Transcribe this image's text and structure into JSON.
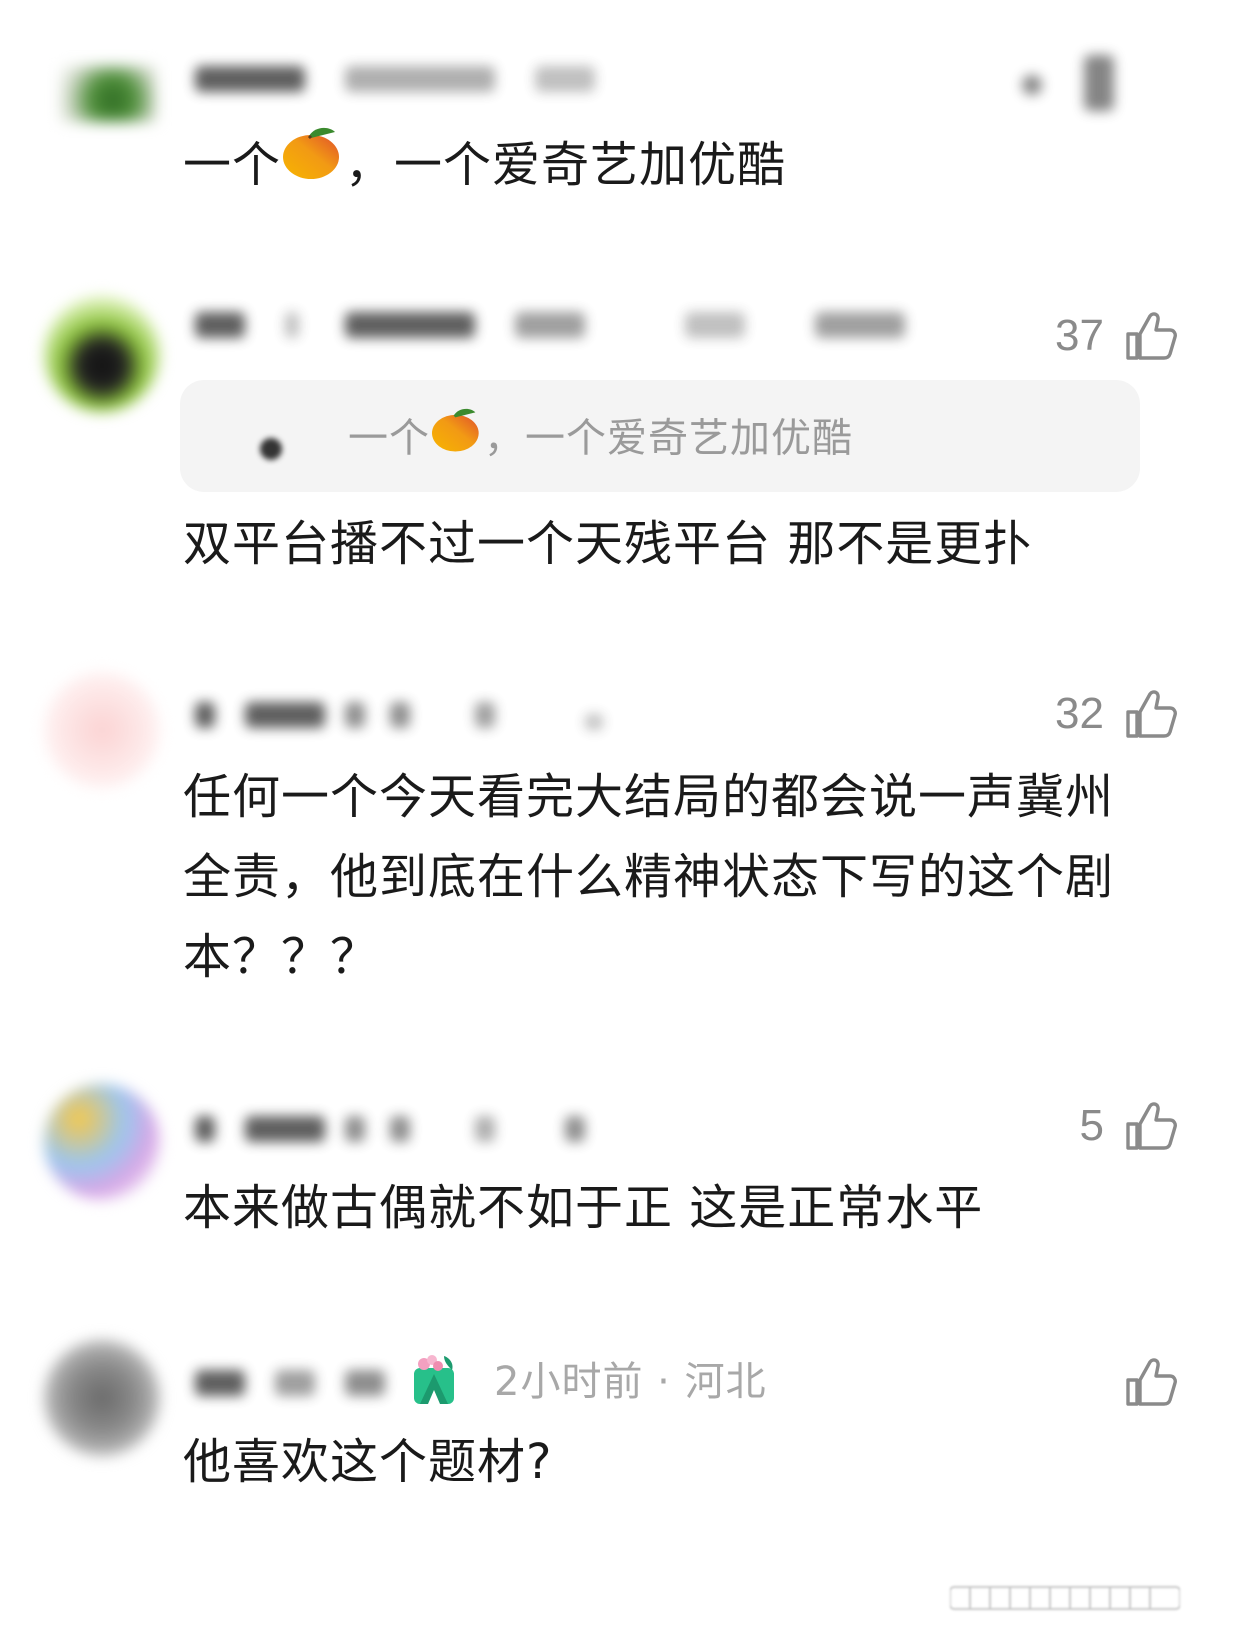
{
  "comments": [
    {
      "text_before": "一个",
      "text_after": "，一个爱奇艺加优酷",
      "text_emoji": "mango"
    },
    {
      "likes": "37",
      "quote_before": "一个",
      "quote_after": "，一个爱奇艺加优酷",
      "text": "双平台播不过一个天残平台 那不是更扑"
    },
    {
      "likes": "32",
      "text": "任何一个今天看完大结局的都会说一声冀州全责，他到底在什么精神状态下写的这个剧本？？？"
    },
    {
      "likes": "5",
      "text": "本来做古偶就不如于正 这是正常水平"
    },
    {
      "time_location": "2小时前 · 河北",
      "text": "他喜欢这个题材?"
    }
  ],
  "icons": {
    "like": "thumbs-up-icon",
    "badge": "plant-badge-icon",
    "emoji": "mango-emoji"
  },
  "colors": {
    "text": "#1a1a1a",
    "secondary": "#8a8a8a",
    "quote_bg": "#f4f4f4"
  }
}
